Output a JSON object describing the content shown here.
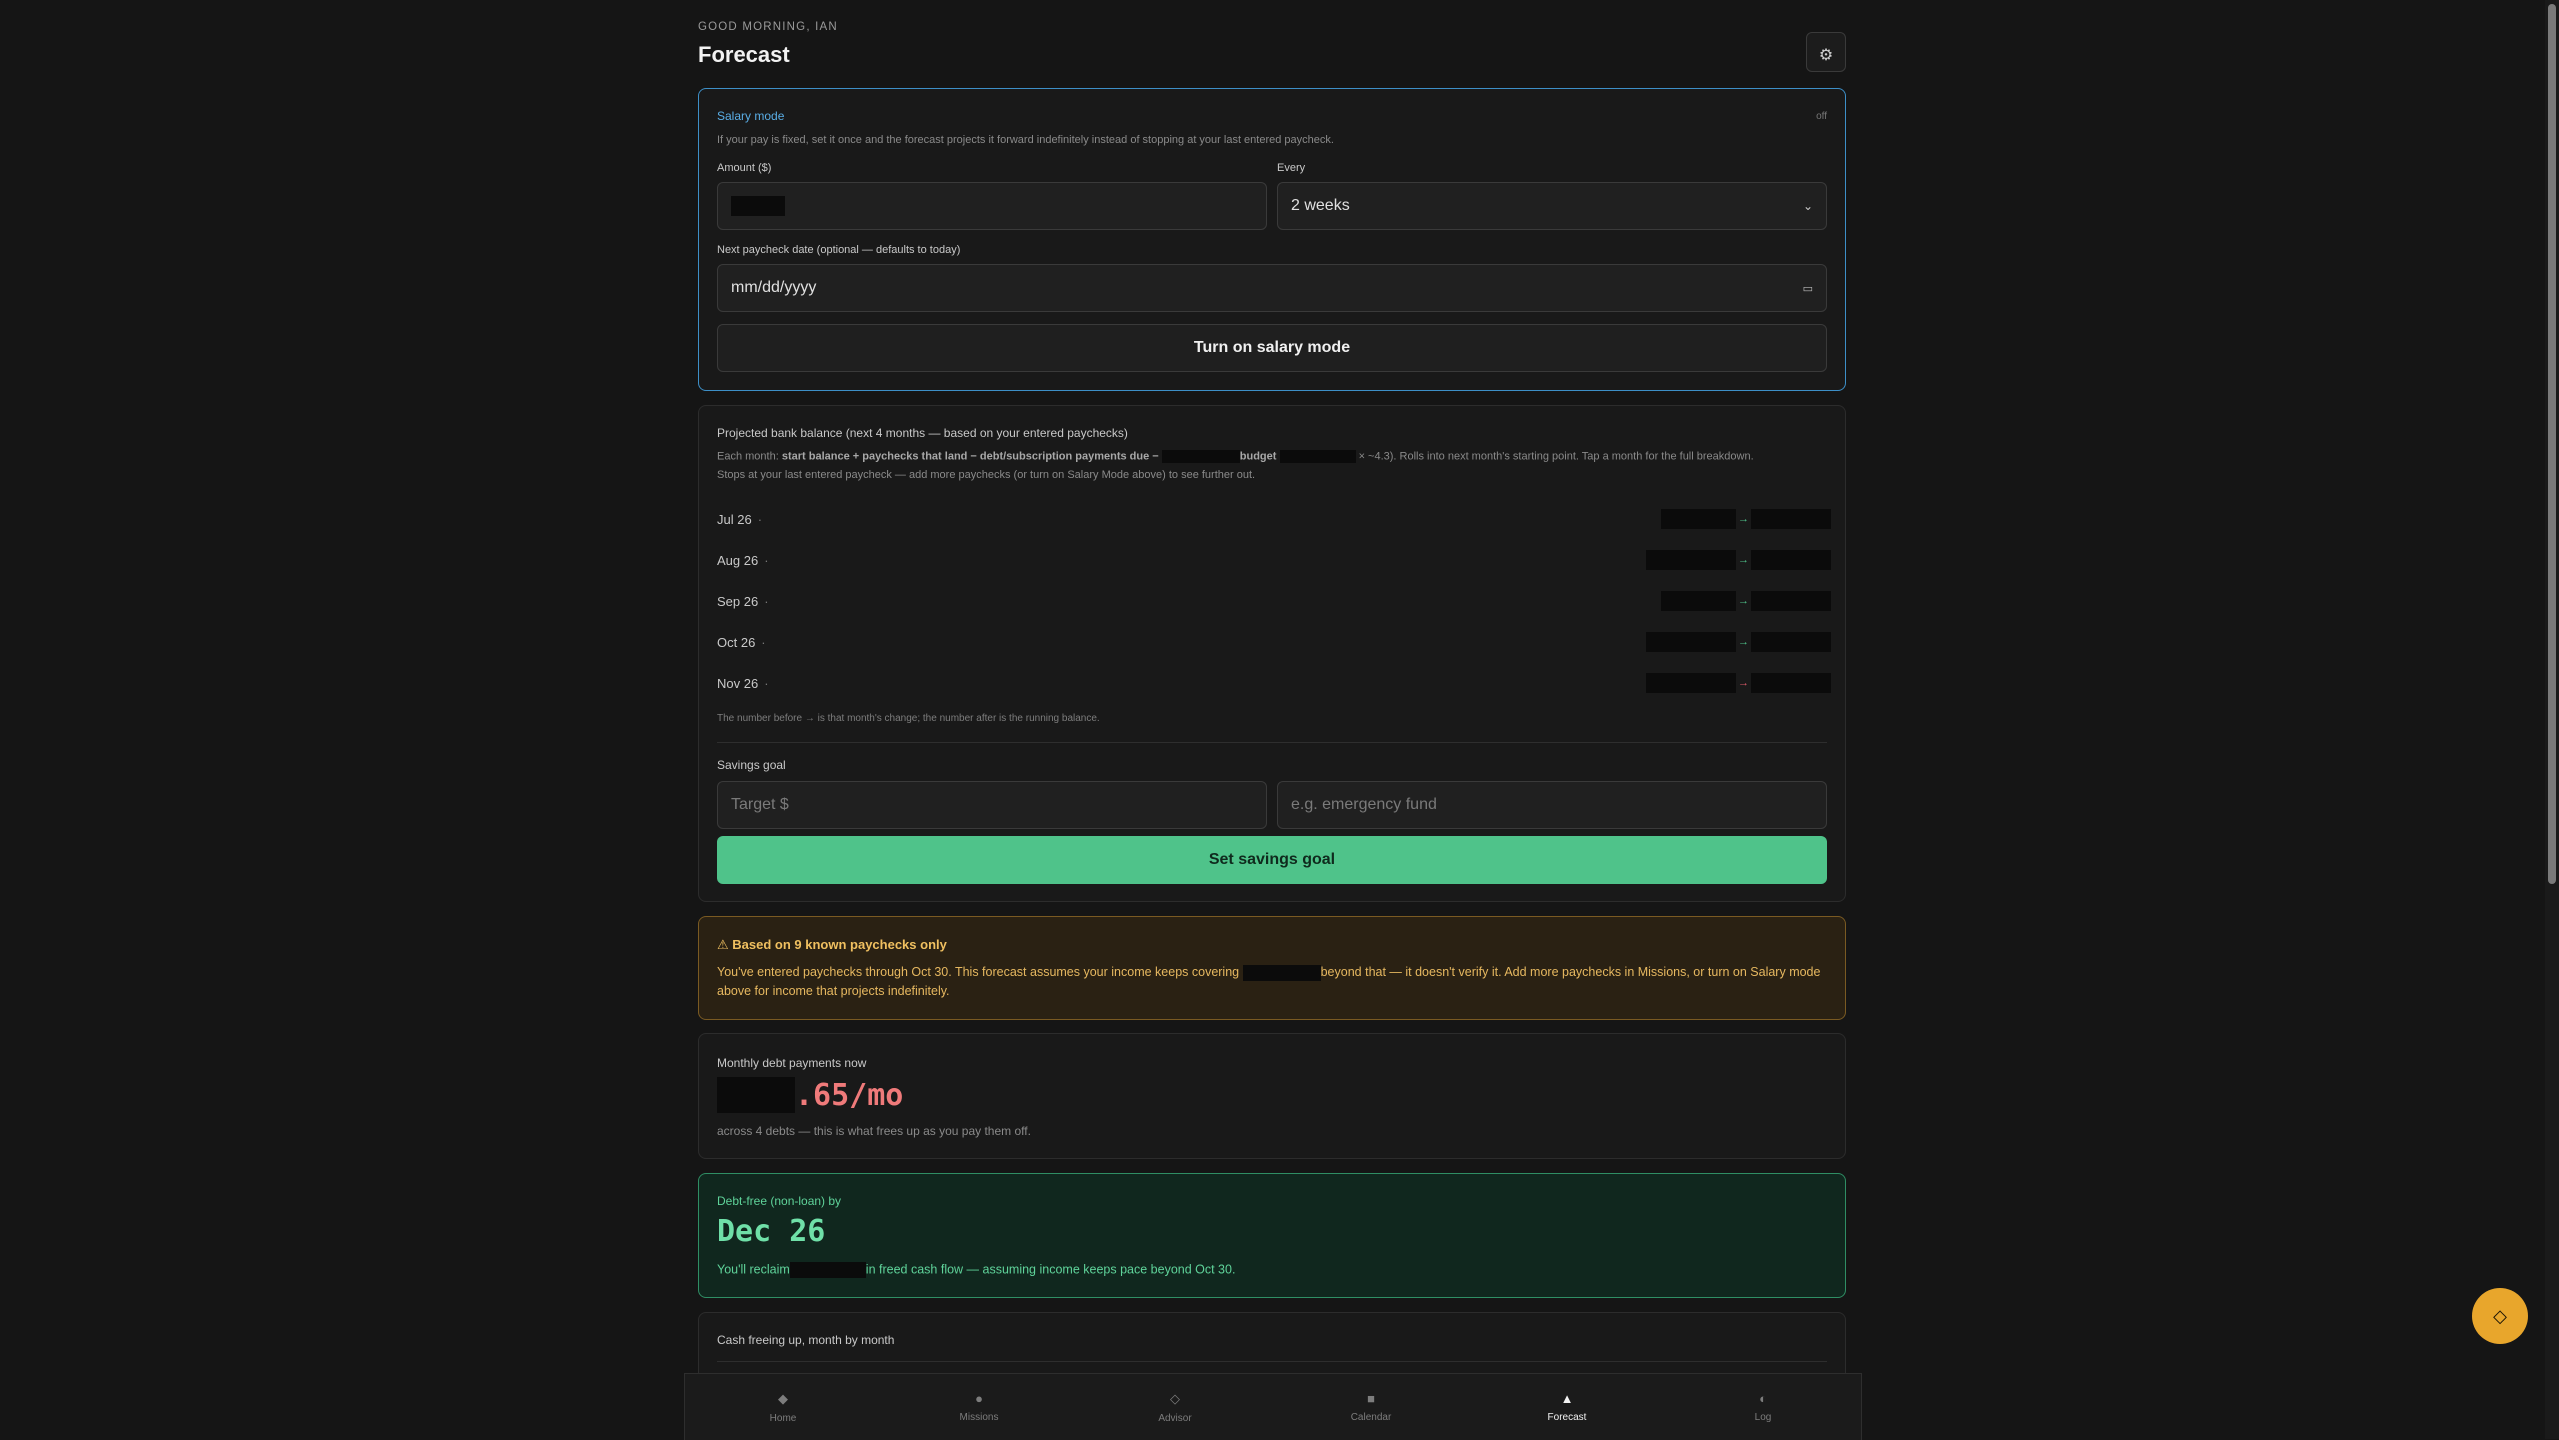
{
  "header": {
    "greeting": "GOOD MORNING, IAN",
    "title": "Forecast",
    "settings_icon": "gear-icon"
  },
  "salary": {
    "heading": "Salary mode",
    "status": "off",
    "description": "If your pay is fixed, set it once and the forecast projects it forward indefinitely instead of stopping at your last entered paycheck.",
    "amount_label": "Amount ($)",
    "every_label": "Every",
    "every_value": "2 weeks",
    "next_date_label": "Next paycheck date (optional — defaults to today)",
    "date_placeholder": "mm/dd/yyyy",
    "button": "Turn on salary mode"
  },
  "projection": {
    "heading": "Projected bank balance (next 4 months — based on your entered paychecks)",
    "formula_prefix": "Each month: ",
    "formula_bold": "start balance + paychecks that land − debt/subscription payments due −",
    "formula_budget": "budget",
    "formula_tail": "× ~4.3). Rolls into next month's starting point. Tap a month for the full breakdown.",
    "formula_line2": "Stops at your last entered paycheck — add more paychecks (or turn on Salary Mode above) to see further out.",
    "months": [
      {
        "label": "Jul 26",
        "sep": "·",
        "arrow": "→",
        "trend": "up"
      },
      {
        "label": "Aug 26",
        "sep": "·",
        "arrow": "→",
        "trend": "up"
      },
      {
        "label": "Sep 26",
        "sep": "·",
        "arrow": "→",
        "trend": "up"
      },
      {
        "label": "Oct 26",
        "sep": "·",
        "arrow": "→",
        "trend": "up"
      },
      {
        "label": "Nov 26",
        "sep": "·",
        "arrow": "→",
        "trend": "down"
      }
    ],
    "footnote": "The number before → is that month's change; the number after is the running balance.",
    "savings_label": "Savings goal",
    "target_placeholder": "Target $",
    "name_placeholder": "e.g. emergency fund",
    "savings_button": "Set savings goal"
  },
  "warning": {
    "icon": "warning-icon",
    "title": "Based on 9 known paychecks only",
    "text_before": "You've entered paychecks through Oct 30. This forecast assumes your income keeps covering",
    "text_after": "beyond that — it doesn't verify it. Add more paychecks in Missions, or turn on Salary mode above for income that projects indefinitely."
  },
  "debt": {
    "label": "Monthly debt payments now",
    "amount_suffix": ".65/mo",
    "sub": "across 4 debts — this is what frees up as you pay them off."
  },
  "debt_free": {
    "label": "Debt-free (non-loan) by",
    "date": "Dec 26",
    "text_before": "You'll reclaim",
    "text_after": "in freed cash flow — assuming income keeps pace beyond Oct 30."
  },
  "cash": {
    "label": "Cash freeing up, month by month"
  },
  "nav": [
    {
      "label": "Home",
      "icon": "home-icon",
      "glyph": "◆",
      "active": false
    },
    {
      "label": "Missions",
      "icon": "missions-icon",
      "glyph": "●",
      "active": false
    },
    {
      "label": "Advisor",
      "icon": "advisor-icon",
      "glyph": "◇",
      "active": false
    },
    {
      "label": "Calendar",
      "icon": "calendar-icon",
      "glyph": "■",
      "active": false
    },
    {
      "label": "Forecast",
      "icon": "forecast-icon",
      "glyph": "▲",
      "active": true
    },
    {
      "label": "Log",
      "icon": "log-icon",
      "glyph": "◐",
      "active": false
    }
  ],
  "fab": {
    "icon": "diamond-icon",
    "glyph": "◇"
  },
  "colors": {
    "accent_blue": "#3d8fc7",
    "green": "#4fc38a",
    "red": "#ef7a7a",
    "amber": "#e8a62c"
  }
}
